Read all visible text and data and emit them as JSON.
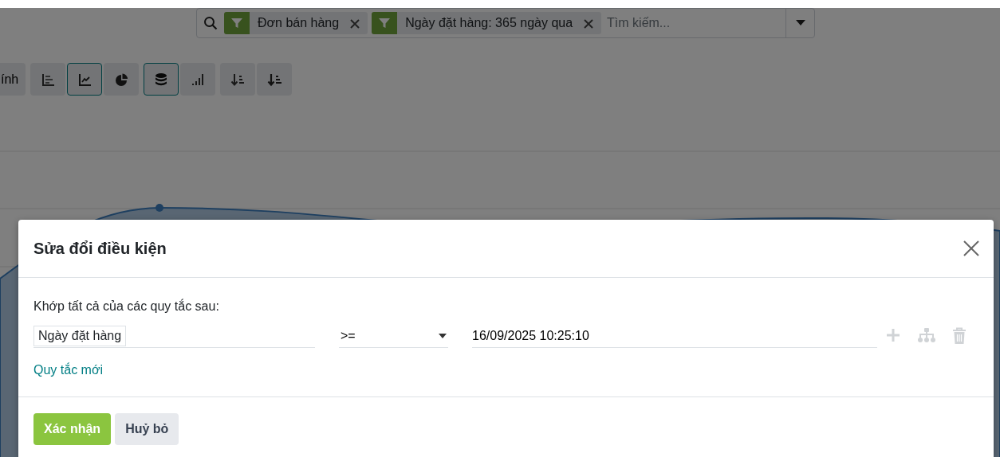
{
  "search": {
    "facets": [
      {
        "label": "Đơn bán hàng"
      },
      {
        "label": "Ngày đặt hàng: 365 ngày qua"
      }
    ],
    "placeholder": "Tìm kiếm..."
  },
  "toolbar": {
    "groups": [
      {
        "buttons": [
          {
            "kind": "text",
            "label": "ính",
            "selected": false
          }
        ]
      },
      {
        "buttons": [
          {
            "kind": "bar",
            "selected": false
          },
          {
            "kind": "line",
            "selected": true
          },
          {
            "kind": "pie",
            "selected": false
          }
        ]
      },
      {
        "buttons": [
          {
            "kind": "stack",
            "selected": true
          },
          {
            "kind": "cumulative",
            "selected": false
          }
        ]
      },
      {
        "buttons": [
          {
            "kind": "sort-desc",
            "selected": false
          },
          {
            "kind": "sort-asc",
            "selected": false
          }
        ]
      }
    ]
  },
  "dialog": {
    "title": "Sửa đổi điều kiện",
    "intro": "Khớp tất cả của các quy tắc sau:",
    "rules": [
      {
        "field": "Ngày đặt hàng",
        "operator": ">=",
        "value": "16/09/2025 10:25:10"
      }
    ],
    "new_rule": "Quy tắc mới",
    "buttons": [
      {
        "kind": "primary",
        "label": "Xác nhận"
      },
      {
        "kind": "secondary",
        "label": "Huỷ bỏ"
      }
    ]
  }
}
